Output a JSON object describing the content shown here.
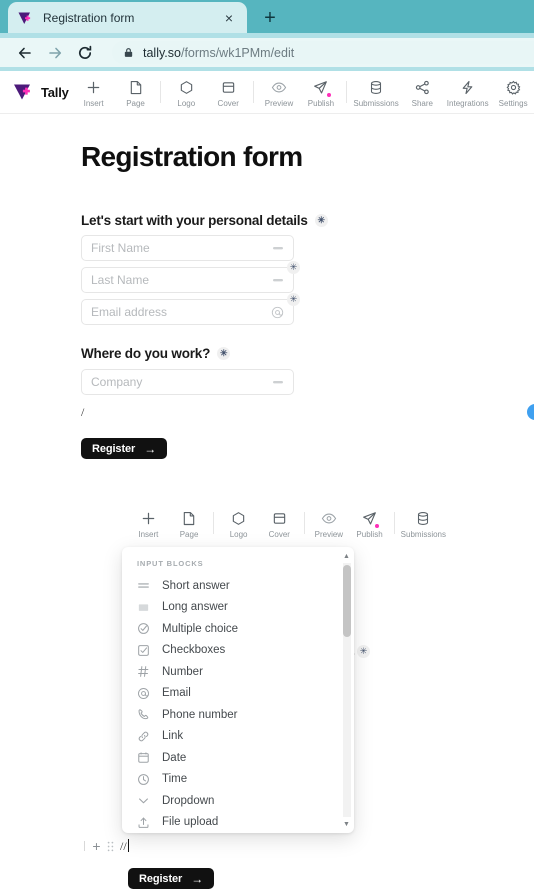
{
  "browser": {
    "tab": {
      "title": "Registration form",
      "favicon": "tally-logo-icon",
      "close_label": "×"
    },
    "new_tab_label": "+",
    "nav": {
      "back": "←",
      "forward": "→",
      "reload": "⟳"
    },
    "omnibox": {
      "lock": "lock-icon",
      "domain": "tally.so",
      "path": "/forms/wk1PMm/edit"
    }
  },
  "app": {
    "brand": "Tally",
    "toolbar": [
      {
        "label": "Insert",
        "icon": "plus-icon"
      },
      {
        "label": "Page",
        "icon": "page-icon"
      },
      {
        "label": "Logo",
        "icon": "hexagon-icon"
      },
      {
        "label": "Cover",
        "icon": "cover-icon"
      },
      {
        "label": "Preview",
        "icon": "eye-icon"
      },
      {
        "label": "Publish",
        "icon": "send-icon",
        "badge": true
      },
      {
        "label": "Submissions",
        "icon": "database-icon"
      },
      {
        "label": "Share",
        "icon": "share-icon"
      },
      {
        "label": "Integrations",
        "icon": "bolt-icon"
      },
      {
        "label": "Settings",
        "icon": "gear-icon"
      }
    ],
    "ghost_toolbar": [
      {
        "label": "Insert",
        "icon": "plus-icon"
      },
      {
        "label": "Page",
        "icon": "page-icon"
      },
      {
        "label": "Logo",
        "icon": "hexagon-icon"
      },
      {
        "label": "Cover",
        "icon": "cover-icon"
      },
      {
        "label": "Preview",
        "icon": "eye-icon"
      },
      {
        "label": "Publish",
        "icon": "send-icon",
        "badge": true
      },
      {
        "label": "Submissions",
        "icon": "database-icon"
      }
    ]
  },
  "form": {
    "title": "Registration form",
    "required_mark": "✳",
    "groups": [
      {
        "label": "Let's start with your personal details"
      },
      {
        "label": "Where do you work?"
      }
    ],
    "fields": [
      {
        "placeholder": "First Name",
        "icon": "short-answer-icon",
        "required": false
      },
      {
        "placeholder": "Last Name",
        "icon": "short-answer-icon",
        "required": true
      },
      {
        "placeholder": "Email address",
        "icon": "at-icon",
        "required": true
      },
      {
        "placeholder": "Company",
        "icon": "short-answer-icon",
        "required": false
      }
    ],
    "slash_text": "/",
    "submit_label": "Register",
    "submit_arrow": "→"
  },
  "dropdown": {
    "header": "INPUT BLOCKS",
    "items": [
      {
        "label": "Short answer",
        "icon": "short-answer-icon"
      },
      {
        "label": "Long answer",
        "icon": "long-answer-icon"
      },
      {
        "label": "Multiple choice",
        "icon": "circle-check-icon"
      },
      {
        "label": "Checkboxes",
        "icon": "square-check-icon"
      },
      {
        "label": "Number",
        "icon": "hash-icon"
      },
      {
        "label": "Email",
        "icon": "at-icon"
      },
      {
        "label": "Phone number",
        "icon": "phone-icon"
      },
      {
        "label": "Link",
        "icon": "link-icon"
      },
      {
        "label": "Date",
        "icon": "calendar-icon"
      },
      {
        "label": "Time",
        "icon": "clock-icon"
      },
      {
        "label": "Dropdown",
        "icon": "chevron-down-icon"
      },
      {
        "label": "File upload",
        "icon": "upload-icon"
      }
    ],
    "scroll_up": "▲",
    "scroll_down": "▼"
  },
  "bottom_row": {
    "plus": "+",
    "grip": "drag-handle-icon",
    "text": "//",
    "submit_label": "Register",
    "submit_arrow": "→"
  },
  "colors": {
    "tabstrip": "#56b5bf",
    "tab_bg": "#d4eef0",
    "toolbar_bg": "#eaf7f7",
    "accent_pink": "#ff2fb9",
    "brand_purple": "#5a1a8f",
    "button_dark": "#111111",
    "bubble_blue": "#3fa0f0"
  }
}
